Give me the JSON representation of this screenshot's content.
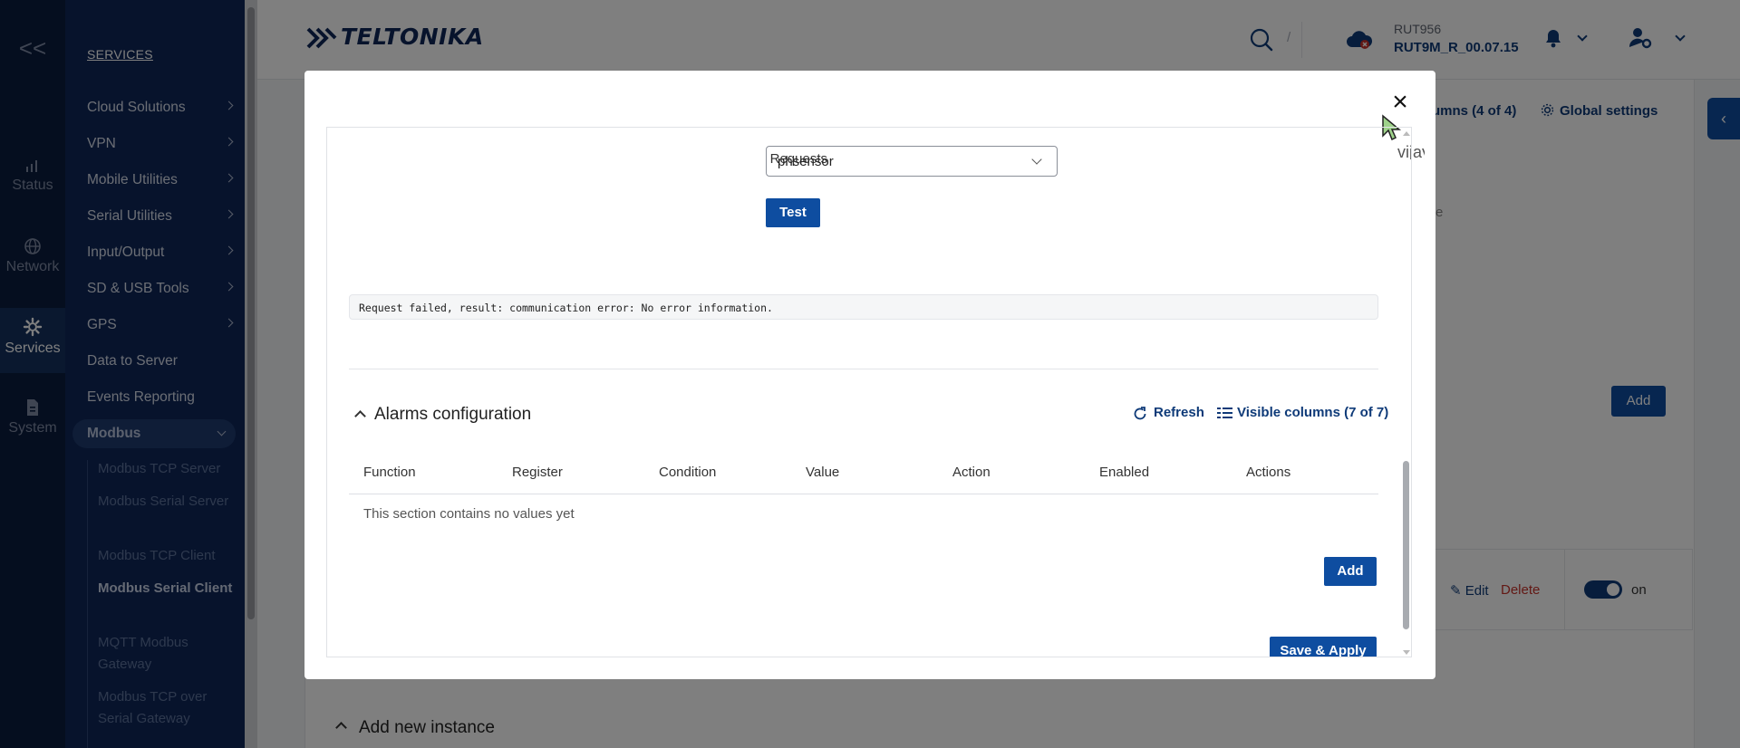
{
  "rail": {
    "collapse": "<<",
    "items": [
      {
        "label": "Status",
        "icon": "bar-chart-icon"
      },
      {
        "label": "Network",
        "icon": "globe-icon"
      },
      {
        "label": "Services",
        "icon": "gear-icon"
      },
      {
        "label": "System",
        "icon": "document-icon"
      }
    ]
  },
  "menu": {
    "title": "SERVICES",
    "items": [
      "Cloud Solutions",
      "VPN",
      "Mobile Utilities",
      "Serial Utilities",
      "Input/Output",
      "SD & USB Tools",
      "GPS",
      "Data to Server",
      "Events Reporting",
      "Modbus"
    ],
    "sub_items": [
      "Modbus TCP Server",
      "Modbus Serial Server",
      "Modbus TCP Client",
      "Modbus Serial Client",
      "MQTT Modbus Gateway",
      "Modbus TCP over Serial Gateway"
    ]
  },
  "header": {
    "logo": "TELTONIKA",
    "search_shortcut": "/",
    "device_name": "RUT956",
    "firmware": "RUT9M_R_00.07.15"
  },
  "background": {
    "columns_link": "umns (4 of 4)",
    "global_settings": "Global settings",
    "add": "Add",
    "edit": "Edit",
    "delete": "Delete",
    "toggle_state": "on",
    "add_new_instance": "Add new instance",
    "partial_letter": "e"
  },
  "modal": {
    "close": "×",
    "overflow_text": "vijay",
    "requests_label": "Requests",
    "requests_value": "phsensor",
    "test_label": "Test",
    "result_text": "Request failed, result: communication error: No error information.",
    "alarms_title": "Alarms configuration",
    "refresh": "Refresh",
    "visible_columns": "Visible columns (7 of 7)",
    "columns": [
      "Function",
      "Register",
      "Condition",
      "Value",
      "Action",
      "Enabled",
      "Actions"
    ],
    "empty_text": "This section contains no values yet",
    "add_label": "Add",
    "save_apply": "Save & Apply"
  },
  "colors": {
    "primary": "#0e4da0",
    "nav_dark": "#0b1d3f",
    "menu_bg": "#0e2758",
    "danger": "#c7332b"
  }
}
